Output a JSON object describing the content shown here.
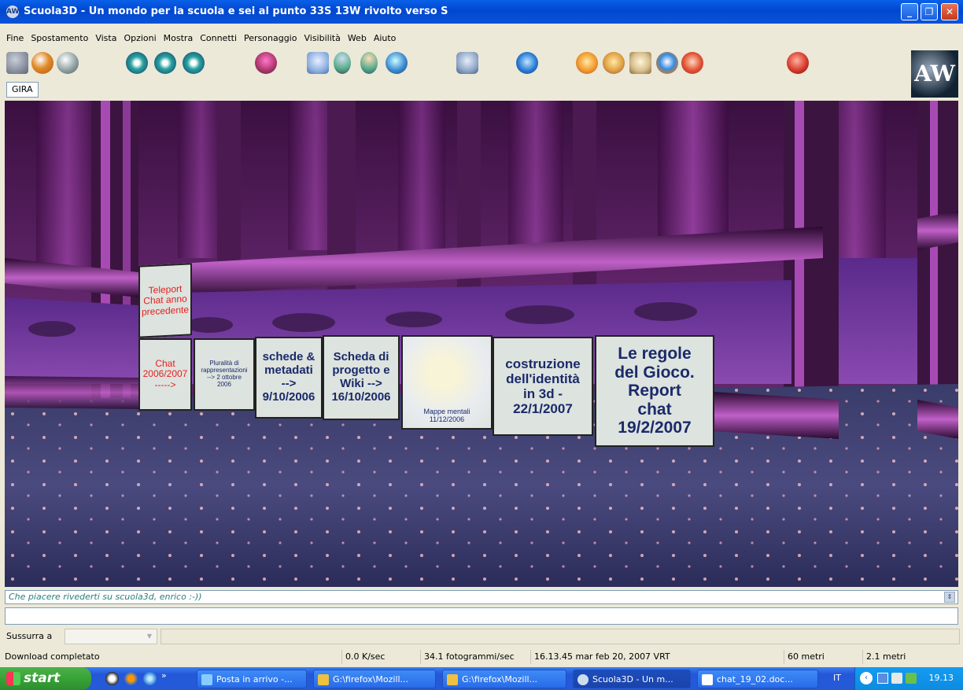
{
  "window": {
    "title": "Scuola3D - Un mondo per la scuola e sei al punto 33S 13W rivolto verso S",
    "app_icon": "AW",
    "controls": {
      "minimize": "_",
      "restore": "❐",
      "close": "✕"
    }
  },
  "menu": [
    "Fine",
    "Spostamento",
    "Vista",
    "Opzioni",
    "Mostra",
    "Connetti",
    "Personaggio",
    "Visibilità",
    "Web",
    "Aiuto"
  ],
  "toolbar": {
    "icons": [
      "home-icon",
      "back-icon",
      "forward-icon",
      "eye-icon",
      "eye-icon",
      "eye-icon",
      "avatars-icon",
      "person-icon",
      "teleport-icon",
      "user-icon",
      "people-icon",
      "chat-icon",
      "browser-icon",
      "build-icon",
      "tools-icon",
      "map-icon",
      "refresh-icon",
      "help-icon",
      "stop-icon"
    ],
    "gira_label": "GIRA",
    "logo_text": "AW"
  },
  "scene": {
    "panels": [
      {
        "id": "teleport",
        "text": "Teleport\nChat anno\nprecedente",
        "color": "#e62020"
      },
      {
        "id": "chat-2006",
        "text": "Chat\n2006/2007\n----->",
        "color": "#e62020"
      },
      {
        "id": "pluralita",
        "text": "Pluralità di\nrappresentazioni\n--> 2 ottobre\n2006",
        "color": "#1a2a6a"
      },
      {
        "id": "schede",
        "text": "schede &\nmetadati\n-->\n9/10/2006",
        "color": "#1a2a6a"
      },
      {
        "id": "scheda-progetto",
        "text": "Scheda di\nprogetto e\nWiki -->\n16/10/2006",
        "color": "#1a2a6a"
      },
      {
        "id": "mappe",
        "text": "Mappe mentali\n11/12/2006",
        "color": "#1a2a6a"
      },
      {
        "id": "costruzione",
        "text": "costruzione\ndell'identità\nin 3d -\n22/1/2007",
        "color": "#1a2a6a"
      },
      {
        "id": "regole",
        "text": "Le regole\ndel Gioco.\nReport\nchat\n19/2/2007",
        "color": "#1a2a6a"
      }
    ]
  },
  "chat": {
    "last_message": "Che piacere rivederti su scuola3d, enrico :-))",
    "input_value": ""
  },
  "whisper": {
    "label": "Sussurra a",
    "selected": ""
  },
  "status": {
    "message": "Download completato",
    "speed": "0.0 K/sec",
    "fps": "34.1 fotogrammi/sec",
    "datetime": "16.13.45 mar feb 20, 2007 VRT",
    "distance1": "60 metri",
    "distance2": "2.1 metri"
  },
  "taskbar": {
    "start_label": "start",
    "tasks": [
      "Posta in arrivo -...",
      "G:\\firefox\\Mozill...",
      "G:\\firefox\\Mozill...",
      "Scuola3D - Un m...",
      "chat_19_02.doc..."
    ],
    "language": "IT",
    "clock": "19.13",
    "chevron": "»"
  }
}
